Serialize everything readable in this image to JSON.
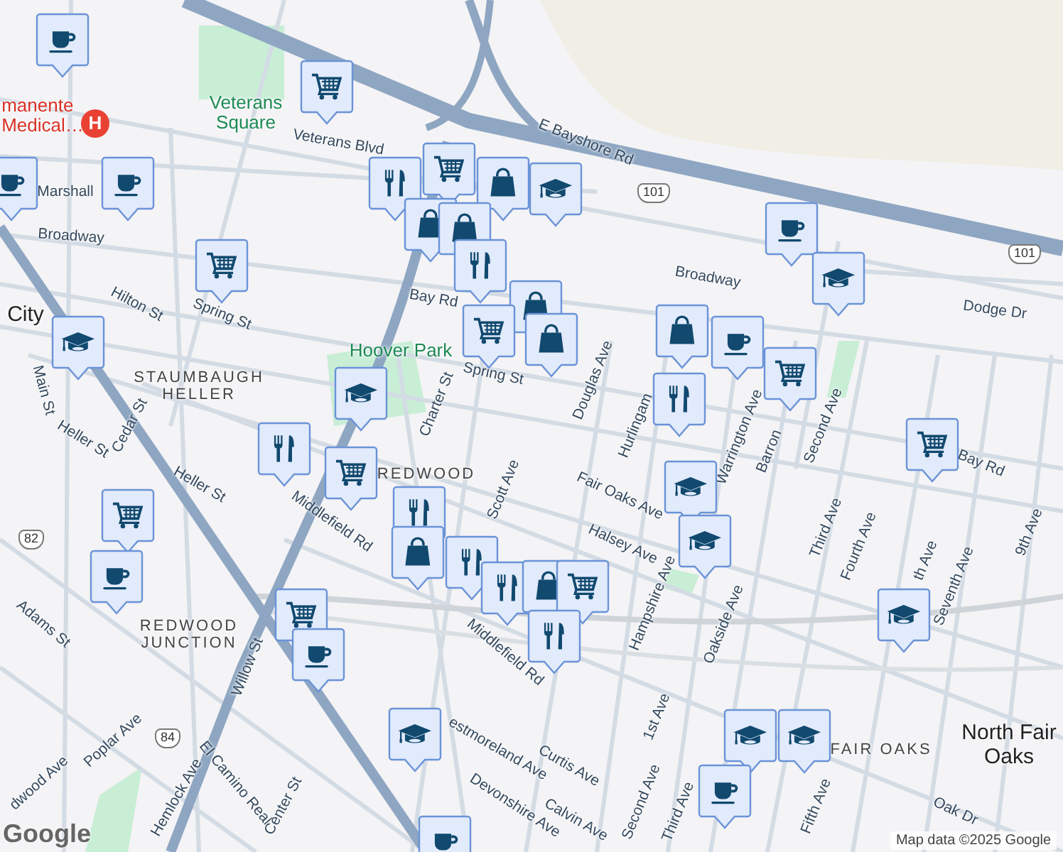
{
  "map": {
    "labels": [
      {
        "text": "manente Medical…",
        "kind": "hospital"
      },
      {
        "text": "H",
        "kind": "poi-badge"
      },
      {
        "text": "Veterans Square",
        "kind": "park"
      },
      {
        "text": "Veterans Blvd",
        "kind": "street"
      },
      {
        "text": "E Bayshore Rd",
        "kind": "street"
      },
      {
        "text": "101",
        "kind": "shield"
      },
      {
        "text": "101",
        "kind": "shield"
      },
      {
        "text": "Marshall",
        "kind": "street"
      },
      {
        "text": "Broadway",
        "kind": "street"
      },
      {
        "text": "Broadway",
        "kind": "street"
      },
      {
        "text": "Hilton St",
        "kind": "street"
      },
      {
        "text": "Spring St",
        "kind": "street"
      },
      {
        "text": "Bay Rd",
        "kind": "street"
      },
      {
        "text": "City",
        "kind": "city"
      },
      {
        "text": "Dodge Dr",
        "kind": "street"
      },
      {
        "text": "Spring St",
        "kind": "street"
      },
      {
        "text": "Hoover Park",
        "kind": "park"
      },
      {
        "text": "STAUMBAUGH HELLER",
        "kind": "area"
      },
      {
        "text": "Main St",
        "kind": "street"
      },
      {
        "text": "Cedar St",
        "kind": "street"
      },
      {
        "text": "Heller St",
        "kind": "street"
      },
      {
        "text": "Heller St",
        "kind": "street"
      },
      {
        "text": "Charter St",
        "kind": "street"
      },
      {
        "text": "Scott Ave",
        "kind": "street"
      },
      {
        "text": "Douglas Ave",
        "kind": "street"
      },
      {
        "text": "Hurlingam",
        "kind": "street"
      },
      {
        "text": "Warrington Ave",
        "kind": "street"
      },
      {
        "text": "Barron",
        "kind": "street"
      },
      {
        "text": "Second Ave",
        "kind": "street"
      },
      {
        "text": "Fair Oaks Ave",
        "kind": "street"
      },
      {
        "text": "Bay Rd",
        "kind": "street"
      },
      {
        "text": "Third Ave",
        "kind": "street"
      },
      {
        "text": "Fourth Ave",
        "kind": "street"
      },
      {
        "text": "th Ave",
        "kind": "street"
      },
      {
        "text": "Seventh Ave",
        "kind": "street"
      },
      {
        "text": "9th Ave",
        "kind": "street"
      },
      {
        "text": "Halsey Ave",
        "kind": "street"
      },
      {
        "text": "Hampshire Ave",
        "kind": "street"
      },
      {
        "text": "Oakside Ave",
        "kind": "street"
      },
      {
        "text": "Middlefield Rd",
        "kind": "street"
      },
      {
        "text": "Middlefield Rd",
        "kind": "street"
      },
      {
        "text": "REDWOOD JUNCTION",
        "kind": "area"
      },
      {
        "text": "REDWOOD",
        "kind": "area"
      },
      {
        "text": "Willow St",
        "kind": "street"
      },
      {
        "text": "Adams St",
        "kind": "street"
      },
      {
        "text": "El Camino Real",
        "kind": "street"
      },
      {
        "text": "Poplar Ave",
        "kind": "street"
      },
      {
        "text": "dwood Ave",
        "kind": "street"
      },
      {
        "text": "Hemlock Ave",
        "kind": "street"
      },
      {
        "text": "Center St",
        "kind": "street"
      },
      {
        "text": "82",
        "kind": "shield"
      },
      {
        "text": "84",
        "kind": "shield"
      },
      {
        "text": "estmoreland Ave",
        "kind": "street"
      },
      {
        "text": "Devonshire Ave",
        "kind": "street"
      },
      {
        "text": "Curtis Ave",
        "kind": "street"
      },
      {
        "text": "Calvin Ave",
        "kind": "street"
      },
      {
        "text": "1st Ave",
        "kind": "street"
      },
      {
        "text": "Second Ave",
        "kind": "street"
      },
      {
        "text": "Third Ave",
        "kind": "street"
      },
      {
        "text": "Fifth Ave",
        "kind": "street"
      },
      {
        "text": "FAIR OAKS",
        "kind": "area"
      },
      {
        "text": "North Fair Oaks",
        "kind": "city"
      },
      {
        "text": "Oak Dr",
        "kind": "street"
      },
      {
        "text": "Google",
        "kind": "logo"
      },
      {
        "text": "Map data ©2025 Google",
        "kind": "attribution"
      }
    ],
    "markers": [
      {
        "kind": "cafe"
      },
      {
        "kind": "cart"
      },
      {
        "kind": "cafe"
      },
      {
        "kind": "cafe"
      },
      {
        "kind": "restaurant"
      },
      {
        "kind": "cart"
      },
      {
        "kind": "bag"
      },
      {
        "kind": "school"
      },
      {
        "kind": "bag"
      },
      {
        "kind": "bag"
      },
      {
        "kind": "restaurant"
      },
      {
        "kind": "cart"
      },
      {
        "kind": "cafe"
      },
      {
        "kind": "school"
      },
      {
        "kind": "bag"
      },
      {
        "kind": "bag"
      },
      {
        "kind": "cafe"
      },
      {
        "kind": "cart"
      },
      {
        "kind": "bag"
      },
      {
        "kind": "restaurant"
      },
      {
        "kind": "cart"
      },
      {
        "kind": "school"
      },
      {
        "kind": "school"
      },
      {
        "kind": "cart"
      },
      {
        "kind": "restaurant"
      },
      {
        "kind": "cart"
      },
      {
        "kind": "restaurant"
      },
      {
        "kind": "bag"
      },
      {
        "kind": "restaurant"
      },
      {
        "kind": "restaurant"
      },
      {
        "kind": "bag"
      },
      {
        "kind": "cart"
      },
      {
        "kind": "restaurant"
      },
      {
        "kind": "school"
      },
      {
        "kind": "school"
      },
      {
        "kind": "cart"
      },
      {
        "kind": "cafe"
      },
      {
        "kind": "cart"
      },
      {
        "kind": "cafe"
      },
      {
        "kind": "school"
      },
      {
        "kind": "school"
      },
      {
        "kind": "school"
      },
      {
        "kind": "cafe"
      },
      {
        "kind": "cafe"
      },
      {
        "kind": "school"
      }
    ]
  }
}
